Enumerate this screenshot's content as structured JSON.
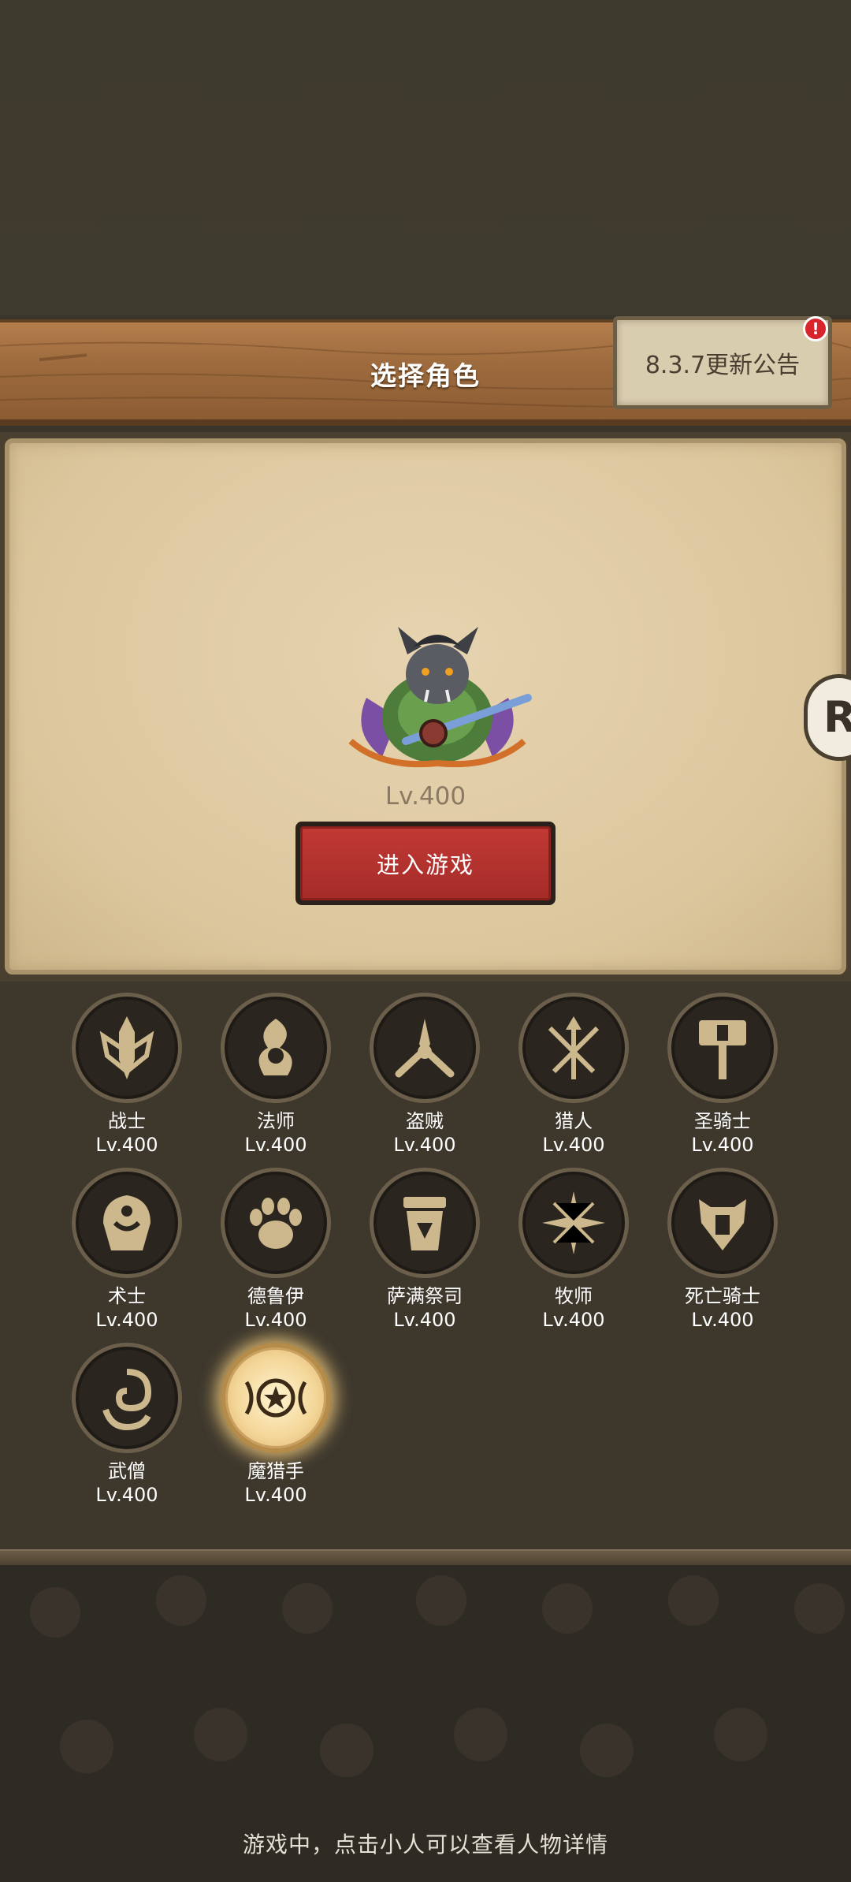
{
  "header": {
    "title": "选择角色",
    "notice_label": "8.3.7更新公告",
    "notice_badge": "!"
  },
  "selected_character": {
    "level": "Lv.400",
    "enter_label": "进入游戏"
  },
  "side_tab": {
    "glyph": "R"
  },
  "classes": [
    {
      "name": "战士",
      "level": "Lv.400",
      "icon": "sword-shield-icon"
    },
    {
      "name": "法师",
      "level": "Lv.400",
      "icon": "arcane-flame-icon"
    },
    {
      "name": "盗贼",
      "level": "Lv.400",
      "icon": "crossed-daggers-icon"
    },
    {
      "name": "猎人",
      "level": "Lv.400",
      "icon": "arrows-icon"
    },
    {
      "name": "圣骑士",
      "level": "Lv.400",
      "icon": "hammer-icon"
    },
    {
      "name": "术士",
      "level": "Lv.400",
      "icon": "demon-skull-icon"
    },
    {
      "name": "德鲁伊",
      "level": "Lv.400",
      "icon": "paw-icon"
    },
    {
      "name": "萨满祭司",
      "level": "Lv.400",
      "icon": "totem-icon"
    },
    {
      "name": "牧师",
      "level": "Lv.400",
      "icon": "holy-star-icon"
    },
    {
      "name": "死亡骑士",
      "level": "Lv.400",
      "icon": "rune-helm-icon"
    },
    {
      "name": "武僧",
      "level": "Lv.400",
      "icon": "swirl-icon"
    },
    {
      "name": "魔猎手",
      "level": "Lv.400",
      "icon": "demon-hunter-icon"
    }
  ],
  "selected_class_index": 11,
  "footer": {
    "hint": "游戏中，点击小人可以查看人物详情"
  },
  "colors": {
    "accent_red": "#b5302c",
    "icon_gold": "#cdb88d",
    "parchment": "#dcc69d",
    "wood": "#9c6a3d"
  }
}
